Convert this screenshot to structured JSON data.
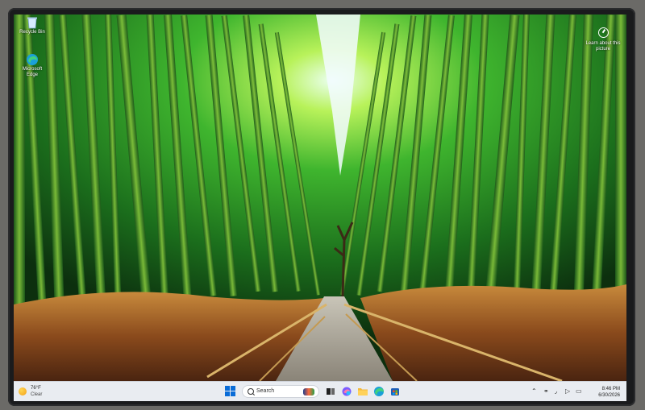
{
  "desktop": {
    "icons": [
      {
        "name": "recycle-bin",
        "label": "Recycle Bin"
      },
      {
        "name": "microsoft-edge",
        "label": "Microsoft Edge"
      }
    ],
    "learn_label": "Learn about this picture"
  },
  "taskbar": {
    "weather": {
      "temp": "76°F",
      "condition": "Clear"
    },
    "search_placeholder": "Search",
    "apps": [
      {
        "name": "task-view",
        "icon": "task-view-icon"
      },
      {
        "name": "copilot",
        "icon": "copilot-icon"
      },
      {
        "name": "file-explorer",
        "icon": "folder-icon"
      },
      {
        "name": "edge",
        "icon": "edge-icon"
      },
      {
        "name": "store",
        "icon": "store-icon"
      }
    ],
    "clock": {
      "time": "8:46 PM",
      "date": "6/30/2026"
    }
  },
  "colors": {
    "accent": "#0a6cd7",
    "taskbar": "#e9ecf1"
  }
}
